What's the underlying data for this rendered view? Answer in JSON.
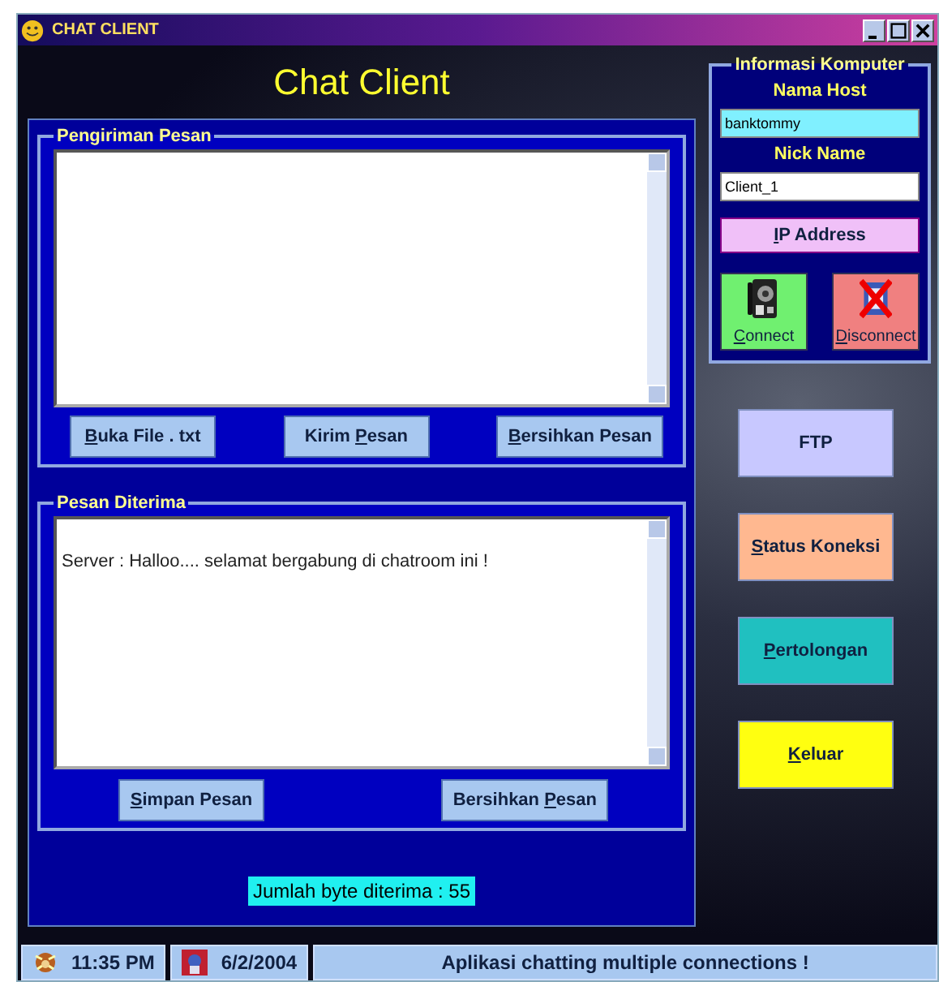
{
  "window": {
    "title": "CHAT CLIENT"
  },
  "header": "Chat Client",
  "send_group": {
    "title": "Pengiriman Pesan",
    "buttons": [
      {
        "key": "B",
        "after": "uka File . txt"
      },
      {
        "before": "Kirim ",
        "key": "P",
        "after": "esan"
      },
      {
        "key": "B",
        "after": "ersihkan Pesan"
      }
    ]
  },
  "receive_group": {
    "title": "Pesan Diterima",
    "message_value": "Server : Halloo.... selamat bergabung di chatroom ini !",
    "buttons": [
      {
        "key": "S",
        "after": "impan Pesan"
      },
      {
        "before": "Bersihkan ",
        "key": "P",
        "after": "esan"
      }
    ]
  },
  "byte_count": "Jumlah byte diterima : 55",
  "computer_info": {
    "title": "Informasi Komputer",
    "host_label": "Nama Host",
    "host_value": "banktommy",
    "nick_label": "Nick Name",
    "nick_value": "Client_1",
    "ip_button": {
      "key": "I",
      "after": "P Address"
    },
    "connect_buttons": [
      {
        "kind": "connect",
        "key": "C",
        "after": "onnect"
      },
      {
        "kind": "disconnect",
        "key": "D",
        "after": "isconnect"
      }
    ]
  },
  "side_buttons": [
    {
      "color": "#c8c8ff",
      "before": "FTP"
    },
    {
      "color": "#ffb890",
      "key": "S",
      "after": "tatus Koneksi"
    },
    {
      "color": "#20c0c0",
      "key": "P",
      "after": "ertolongan"
    },
    {
      "color": "#ffff10",
      "key": "K",
      "after": "eluar"
    }
  ],
  "status_bar": {
    "time": "11:35 PM",
    "date": "6/2/2004",
    "message": "Aplikasi chatting multiple connections !"
  }
}
